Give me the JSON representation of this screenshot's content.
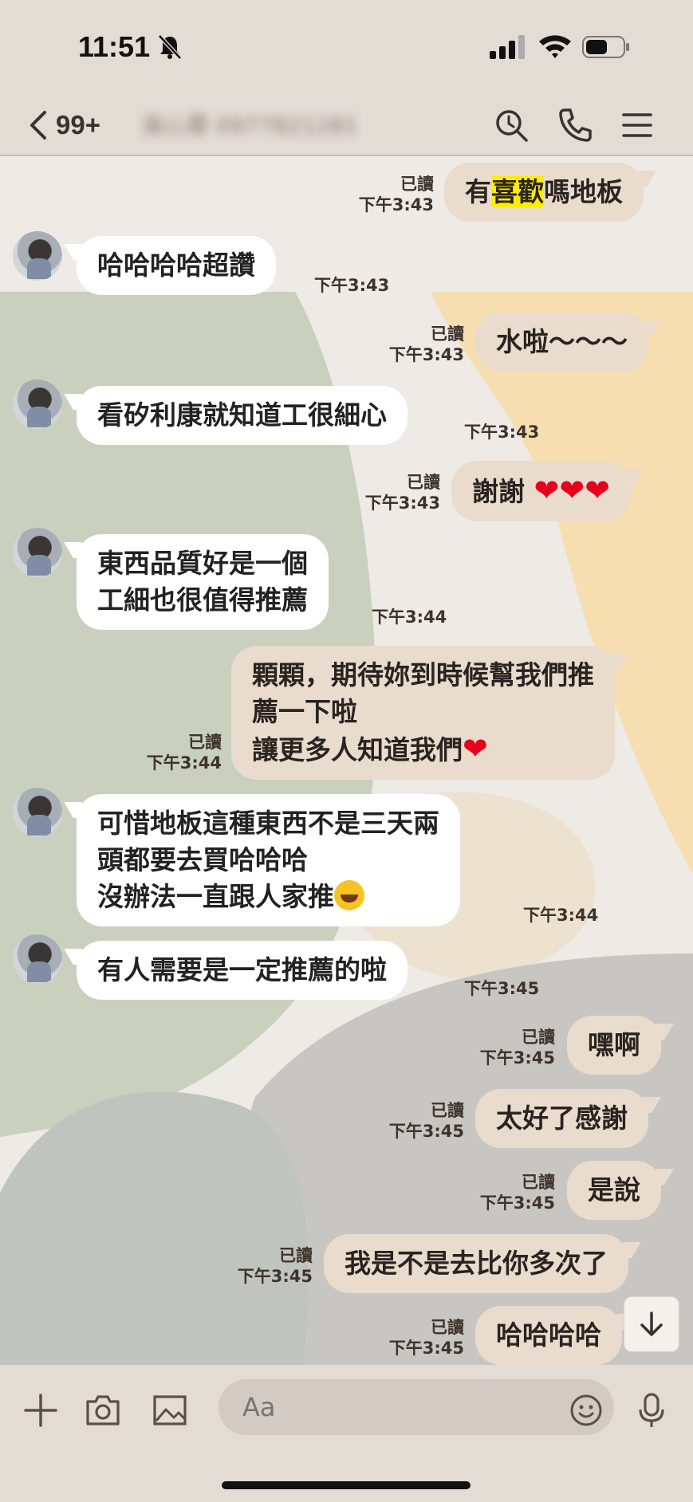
{
  "status_bar": {
    "time": "11:51"
  },
  "header": {
    "back_count": "99+",
    "contact_name": "吳心蓉 0977821281"
  },
  "input": {
    "placeholder": "Aa"
  },
  "messages": [
    {
      "dir": "out",
      "text": "有喜歡嗎地板",
      "read": "已讀",
      "time": "下午3:43"
    },
    {
      "dir": "in",
      "text": "哈哈哈哈超讚",
      "time": "下午3:43"
    },
    {
      "dir": "out",
      "text": "水啦～～～",
      "read": "已讀",
      "time": "下午3:43"
    },
    {
      "dir": "in",
      "text": "看矽利康就知道工很細心",
      "time": "下午3:43"
    },
    {
      "dir": "out",
      "text": "謝謝",
      "read": "已讀",
      "time": "下午3:43"
    },
    {
      "dir": "in",
      "line1": "東西品質好是一個",
      "line2": "工細也很值得推薦",
      "time": "下午3:44"
    },
    {
      "dir": "out",
      "line1": "顆顆，期待妳到時候幫我們推",
      "line2": "薦一下啦",
      "line3": "讓更多人知道我們",
      "read": "已讀",
      "time": "下午3:44"
    },
    {
      "dir": "in",
      "line1": "可惜地板這種東西不是三天兩",
      "line2": "頭都要去買哈哈哈",
      "line3": "沒辦法一直跟人家推",
      "time": "下午3:44"
    },
    {
      "dir": "in",
      "text": "有人需要是一定推薦的啦",
      "time": "下午3:45"
    },
    {
      "dir": "out",
      "text": "嘿啊",
      "read": "已讀",
      "time": "下午3:45"
    },
    {
      "dir": "out",
      "text": "太好了感謝",
      "read": "已讀",
      "time": "下午3:45"
    },
    {
      "dir": "out",
      "text": "是說",
      "read": "已讀",
      "time": "下午3:45"
    },
    {
      "dir": "out",
      "text": "我是不是去比你多次了",
      "read": "已讀",
      "time": "下午3:45"
    },
    {
      "dir": "out",
      "text": "哈哈哈哈",
      "read": "已讀",
      "time": "下午3:45"
    }
  ],
  "hl_text": {
    "pre": "有",
    "hl": "喜歡",
    "post": "嗎地板"
  },
  "colors": {
    "bubble_out": "#e9dccd",
    "bubble_in": "#ffffff",
    "highlight": "#ffee00",
    "heart": "#e6001e"
  }
}
